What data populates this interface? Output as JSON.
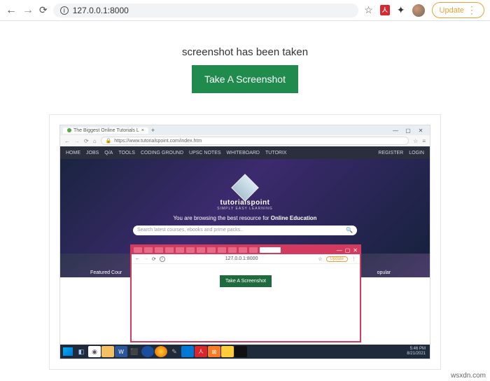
{
  "browser": {
    "url": "127.0.0.1:8000",
    "update_label": "Update"
  },
  "page": {
    "message": "screenshot has been taken",
    "button": "Take A Screenshot"
  },
  "captured": {
    "tab_title": "The Biggest Online Tutorials L",
    "url": "https://www.tutorialspoint.com/index.htm",
    "nav": [
      "HOME",
      "JOBS",
      "Q/A",
      "TOOLS",
      "CODING GROUND",
      "UPSC NOTES",
      "WHITEBOARD",
      "TUTORIX"
    ],
    "nav_right": [
      "REGISTER",
      "LOGIN"
    ],
    "brand": "tutorialspoint",
    "brand_sub": "SIMPLY  EASY  LEARNING",
    "tagline_a": "You are browsing the best resource for ",
    "tagline_b": "Online Education",
    "search_placeholder": "Search latest courses, ebooks and prime packs..",
    "promos": [
      "Featured Cour",
      "",
      "",
      "opular"
    ],
    "inner": {
      "url": "127.0.0.1:8000",
      "update": "Update",
      "button": "Take A Screenshot"
    },
    "time1": "5:46 PM",
    "time2": "8/21/2021"
  },
  "watermark": "wsxdn.com"
}
